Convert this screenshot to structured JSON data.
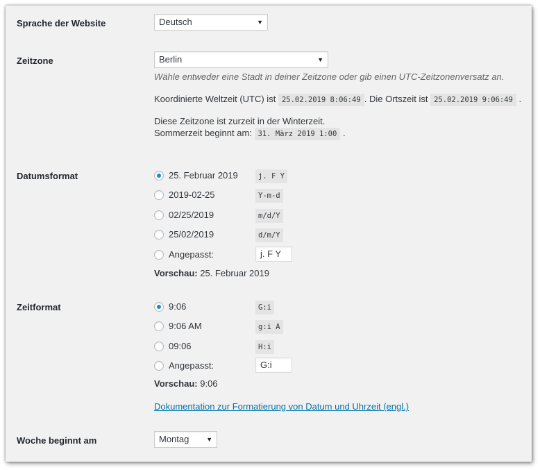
{
  "language": {
    "label": "Sprache der Website",
    "value": "Deutsch"
  },
  "timezone": {
    "label": "Zeitzone",
    "value": "Berlin",
    "description": "Wähle entweder eine Stadt in deiner Zeitzone oder gib einen UTC-Zeitzonenversatz an.",
    "utc_prefix": "Koordinierte Weltzeit (UTC) ist",
    "utc_value": "25.02.2019 8:06:49",
    "local_prefix": ". Die Ortszeit ist",
    "local_value": "25.02.2019 9:06:49",
    "local_suffix": ".",
    "winter_note": "Diese Zeitzone ist zurzeit in der Winterzeit.",
    "dst_prefix": "Sommerzeit beginnt am:",
    "dst_value": "31. März 2019 1:00",
    "dst_suffix": "."
  },
  "date_format": {
    "label": "Datumsformat",
    "options": [
      {
        "label": "25. Februar 2019",
        "code": "j. F Y",
        "checked": true
      },
      {
        "label": "2019-02-25",
        "code": "Y-m-d",
        "checked": false
      },
      {
        "label": "02/25/2019",
        "code": "m/d/Y",
        "checked": false
      },
      {
        "label": "25/02/2019",
        "code": "d/m/Y",
        "checked": false
      }
    ],
    "custom_label": "Angepasst:",
    "custom_value": "j. F Y",
    "preview_label": "Vorschau:",
    "preview_value": "25. Februar 2019"
  },
  "time_format": {
    "label": "Zeitformat",
    "options": [
      {
        "label": "9:06",
        "code": "G:i",
        "checked": true
      },
      {
        "label": "9:06 AM",
        "code": "g:i A",
        "checked": false
      },
      {
        "label": "09:06",
        "code": "H:i",
        "checked": false
      }
    ],
    "custom_label": "Angepasst:",
    "custom_value": "G:i",
    "preview_label": "Vorschau:",
    "preview_value": "9:06",
    "doc_link": "Dokumentation zur Formatierung von Datum und Uhrzeit (engl.)"
  },
  "week_start": {
    "label": "Woche beginnt am",
    "value": "Montag"
  },
  "colors": {
    "accent": "#1e8cbe",
    "link": "#0073aa",
    "background": "#f1f1f1"
  }
}
